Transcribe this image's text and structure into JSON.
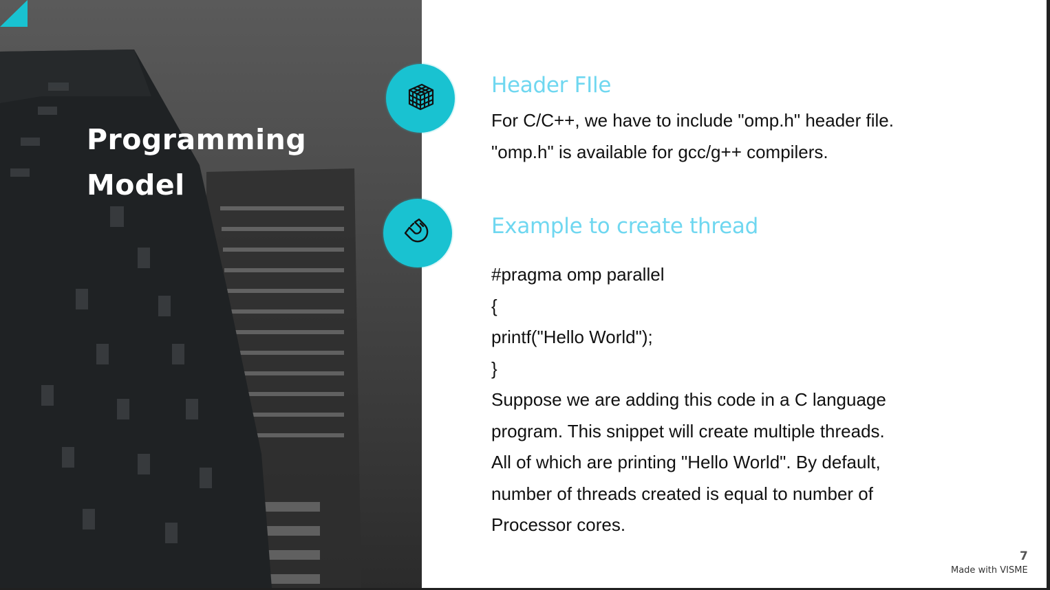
{
  "slide": {
    "title_line1": "Programming",
    "title_line2": "Model",
    "accent_color": "#19c2d1",
    "heading_color": "#6fd7f0"
  },
  "sections": [
    {
      "icon": "cube-grid-icon",
      "heading": "Header FIle",
      "lines": [
        "For C/C++, we have to include \"omp.h\" header file.",
        "\"omp.h\" is available for gcc/g++ compilers."
      ]
    },
    {
      "icon": "magnet-icon",
      "heading": "Example to create thread",
      "code": [
        "#pragma omp parallel",
        "{",
        "printf(\"Hello World\");",
        "}"
      ],
      "lines": [
        "Suppose we are adding this code in a C language",
        "program. This snippet will create multiple threads.",
        "All of which are printing \"Hello World\". By default,",
        "number of threads created is equal to number of",
        "Processor cores."
      ]
    }
  ],
  "footer": {
    "page_number": "7",
    "watermark": "Made with VISME"
  }
}
